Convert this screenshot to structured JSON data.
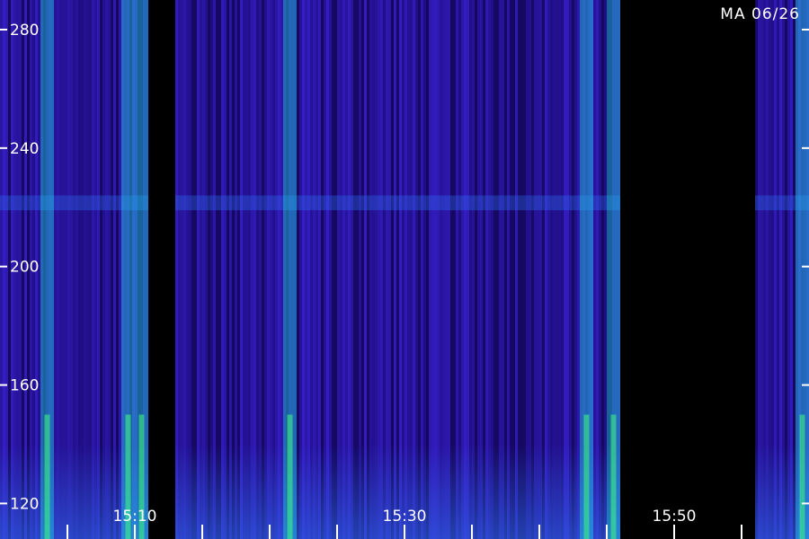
{
  "station_label": "MA 06/26",
  "chart_data": {
    "type": "heatmap",
    "title": "",
    "xlabel": "",
    "ylabel": "",
    "x_ticks": [
      {
        "time": "15:10",
        "label": "15:10"
      },
      {
        "time": "15:30",
        "label": "15:30"
      },
      {
        "time": "15:50",
        "label": "15:50"
      }
    ],
    "x_range": [
      "15:00",
      "16:00"
    ],
    "minor_tick_interval_minutes": 5,
    "y_ticks": [
      120,
      160,
      200,
      240,
      280
    ],
    "y_range": [
      108,
      290
    ],
    "colormap": [
      "#000000",
      "#1a0a6e",
      "#3a22d8",
      "#2f6ff0",
      "#1fd0e0",
      "#40ff80",
      "#d8ff40"
    ],
    "bright_bands": [
      {
        "start": "15:03",
        "end": "15:04"
      },
      {
        "start": "15:09",
        "end": "15:10"
      },
      {
        "start": "15:10",
        "end": "15:11"
      },
      {
        "start": "15:21",
        "end": "15:22"
      },
      {
        "start": "15:43",
        "end": "15:44"
      },
      {
        "start": "15:45",
        "end": "15:46"
      },
      {
        "start": "15:59",
        "end": "16:00"
      }
    ],
    "dark_gaps": [
      {
        "start": "15:11",
        "end": "15:13"
      },
      {
        "start": "15:46",
        "end": "15:56"
      }
    ]
  }
}
